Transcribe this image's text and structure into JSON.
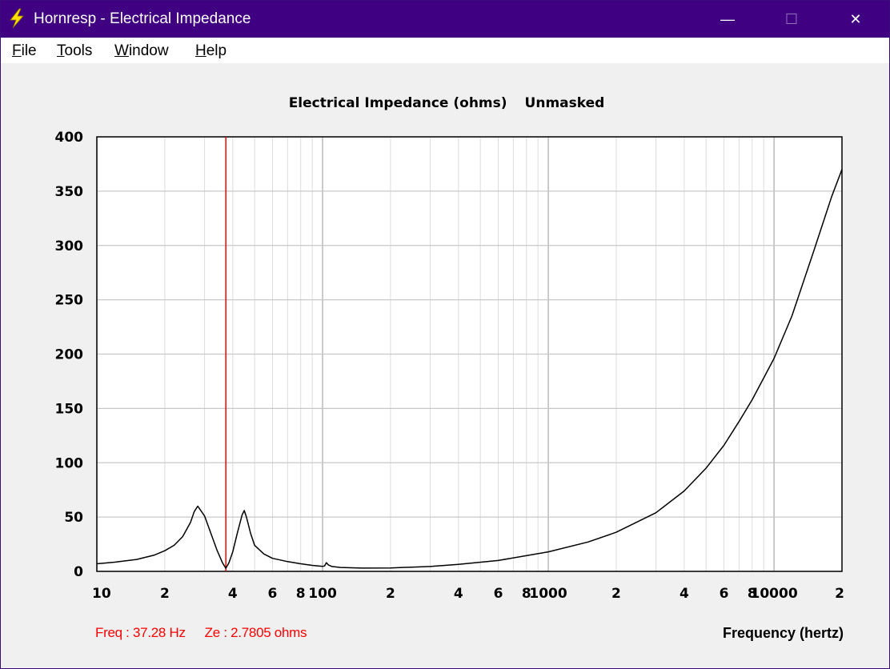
{
  "window": {
    "title": "Hornresp - Electrical Impedance",
    "icon": "lightning-bolt-icon",
    "controls": {
      "minimize": "—",
      "maximize": "☐",
      "close": "✕"
    }
  },
  "menu": {
    "items": [
      {
        "accel": "F",
        "rest": "ile"
      },
      {
        "accel": "T",
        "rest": "ools"
      },
      {
        "accel": "W",
        "rest": "indow"
      },
      {
        "accel": "H",
        "rest": "elp"
      }
    ]
  },
  "readout": {
    "freq": "Freq : 37.28 Hz",
    "ze": "Ze : 2.7805 ohms"
  },
  "colors": {
    "titlebar": "#3f0082",
    "curve": "#000000",
    "cursor": "#ff0000",
    "grid": "#c8c8c8",
    "plot_bg": "#ffffff"
  },
  "chart_data": {
    "type": "line",
    "title": "Electrical Impedance (ohms)",
    "mode": "Unmasked",
    "xlabel": "Frequency (hertz)",
    "ylabel": "",
    "x_scale": "log",
    "xlim": [
      10,
      20000
    ],
    "ylim": [
      0,
      400
    ],
    "y_ticks": [
      0,
      50,
      100,
      150,
      200,
      250,
      300,
      350,
      400
    ],
    "y_tick_labels": [
      "0",
      "50",
      "100",
      "150",
      "200",
      "250",
      "300",
      "350",
      "400"
    ],
    "x_ticks": [
      10,
      20,
      40,
      60,
      80,
      100,
      200,
      400,
      600,
      800,
      1000,
      2000,
      4000,
      6000,
      8000,
      10000,
      20000
    ],
    "x_tick_labels": [
      "10",
      "2",
      "4",
      "6",
      "8",
      "100",
      "2",
      "4",
      "6",
      "8",
      "1000",
      "2",
      "4",
      "6",
      "8",
      "10000",
      "2"
    ],
    "grid": true,
    "cursor_x": 37.28,
    "series": [
      {
        "x": [
          10,
          12,
          15,
          18,
          20,
          22,
          24,
          26,
          27,
          28,
          30,
          32,
          34,
          36,
          37.28,
          38.5,
          40,
          42,
          44,
          45,
          46,
          48,
          50,
          55,
          60,
          70,
          80,
          90,
          100,
          102,
          104,
          106,
          110,
          120,
          150,
          200,
          300,
          400,
          600,
          1000,
          1500,
          2000,
          3000,
          4000,
          5000,
          6000,
          7000,
          8000,
          9000,
          10000,
          12000,
          15000,
          18000,
          20000
        ],
        "y": [
          7,
          8.5,
          11,
          15,
          19,
          24,
          32,
          45,
          55,
          60,
          51,
          35,
          20,
          8,
          2.8,
          8,
          18,
          36,
          52,
          56,
          50,
          35,
          24,
          16,
          12,
          9,
          7,
          5.5,
          4.6,
          5,
          8,
          6,
          4.5,
          3.6,
          3,
          3.2,
          4.5,
          6.5,
          10,
          18,
          27,
          36,
          54,
          74,
          95,
          116,
          138,
          158,
          178,
          196,
          235,
          295,
          345,
          370
        ]
      }
    ]
  }
}
